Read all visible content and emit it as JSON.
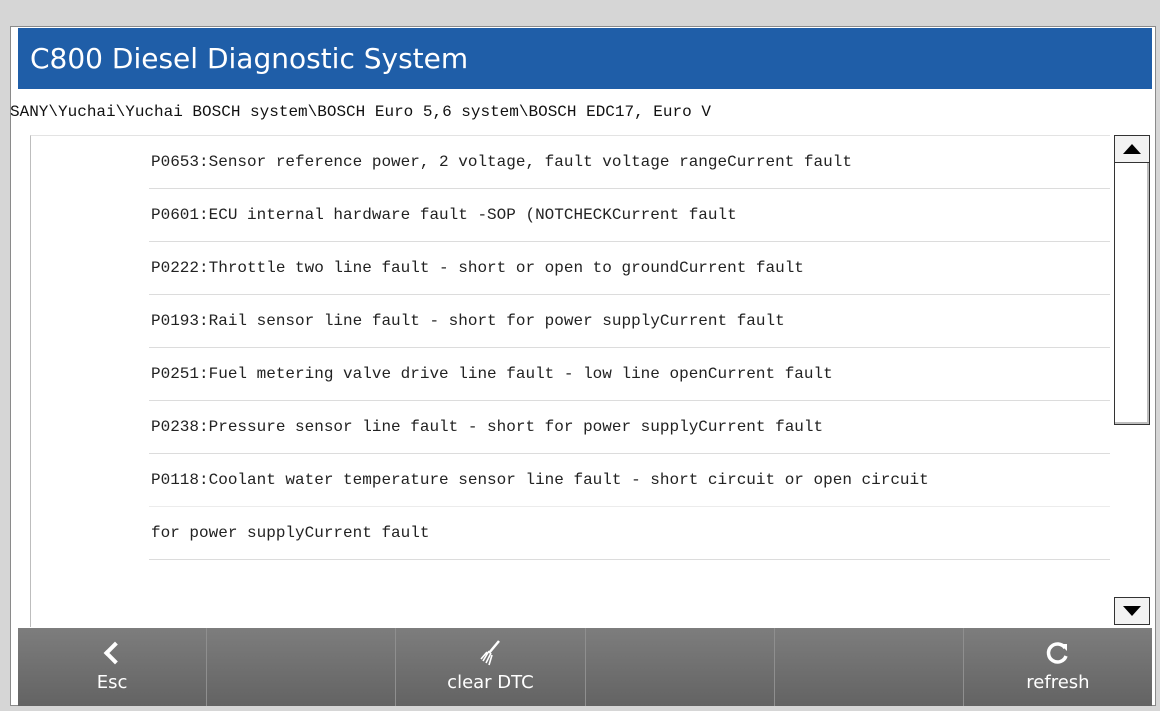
{
  "app": {
    "title": "C800 Diesel Diagnostic System"
  },
  "breadcrumb": "SANY\\Yuchai\\Yuchai BOSCH system\\BOSCH Euro 5,6 system\\BOSCH EDC17, Euro V",
  "faults": [
    "P0653:Sensor reference power, 2 voltage, fault voltage rangeCurrent fault",
    "P0601:ECU internal hardware fault -SOP (NOTCHECKCurrent fault",
    "P0222:Throttle two line fault - short or open to groundCurrent fault",
    "P0193:Rail sensor line fault - short for power supplyCurrent fault",
    "P0251:Fuel metering valve drive line fault - low line openCurrent fault",
    "P0238:Pressure sensor line fault - short for power supplyCurrent fault",
    "P0118:Coolant water temperature sensor line fault - short circuit or open circuit",
    "for power supplyCurrent fault"
  ],
  "toolbar": {
    "esc_label": "Esc",
    "clear_label": "clear DTC",
    "refresh_label": "refresh"
  },
  "icons": {
    "esc": "chevron-left-icon",
    "clear": "broom-icon",
    "refresh": "refresh-icon",
    "scroll_up": "arrow-up-icon",
    "scroll_down": "arrow-down-icon"
  },
  "colors": {
    "title_bar": "#1f5ea8",
    "toolbar": "#6f6f6f"
  }
}
